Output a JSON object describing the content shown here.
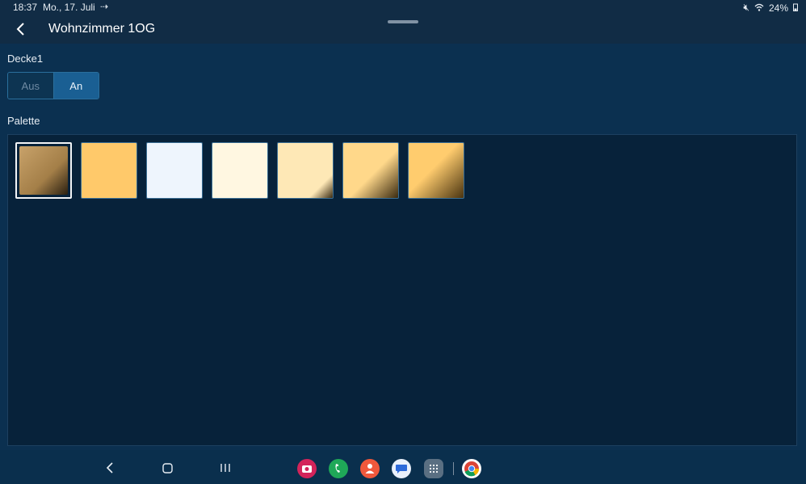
{
  "status_bar": {
    "time": "18:37",
    "date": "Mo., 17. Juli",
    "battery": "24%"
  },
  "header": {
    "title": "Wohnzimmer 1OG"
  },
  "light": {
    "name": "Decke1",
    "toggle": {
      "off_label": "Aus",
      "on_label": "An",
      "selected": "An"
    }
  },
  "palette": {
    "label": "Palette",
    "swatches": [
      {
        "colors": [
          "#c8a26a",
          "#2a1f10"
        ],
        "selected": true
      },
      {
        "colors": [
          "#ffc96a"
        ],
        "selected": false
      },
      {
        "colors": [
          "#eef5fd"
        ],
        "selected": false
      },
      {
        "colors": [
          "#fff7e1"
        ],
        "selected": false
      },
      {
        "colors": [
          "#fee8b6",
          "#3a2b12"
        ],
        "selected": false
      },
      {
        "colors": [
          "#ffd88a",
          "#3a2a10"
        ],
        "selected": false
      },
      {
        "colors": [
          "#ffcc6e",
          "#4a3410"
        ],
        "selected": false
      }
    ]
  },
  "colors": {
    "background": "#0a2f4d",
    "header": "#112c45",
    "accent": "#1a5f93",
    "palette_bg": "#07223a"
  },
  "nav_bar": {
    "buttons": [
      "back-icon",
      "home-icon",
      "recents-icon"
    ],
    "apps": [
      "camera-app-icon",
      "phone-app-icon",
      "contacts-app-icon",
      "messages-app-icon",
      "app-drawer-icon",
      "chrome-app-icon"
    ]
  }
}
